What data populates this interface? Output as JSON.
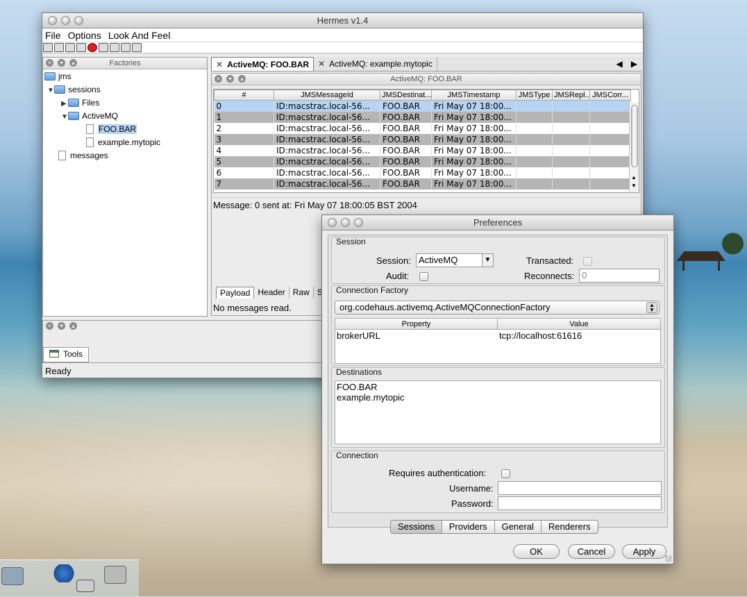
{
  "hermes": {
    "title": "Hermes v1.4",
    "menu": [
      "File",
      "Options",
      "Look And Feel"
    ],
    "factories_title": "Factories",
    "tree": [
      {
        "label": "jms"
      },
      {
        "label": "sessions"
      },
      {
        "label": "Files"
      },
      {
        "label": "ActiveMQ"
      },
      {
        "label": "FOO.BAR"
      },
      {
        "label": "example.mytopic"
      },
      {
        "label": "messages"
      }
    ],
    "tabs": [
      "ActiveMQ: FOO.BAR",
      "ActiveMQ: example.mytopic"
    ],
    "panel_title": "ActiveMQ: FOO.BAR",
    "columns": [
      "#",
      "JMSMessageId",
      "JMSDestinat...",
      "JMSTimestamp",
      "JMSType",
      "JMSRepl...",
      "JMSCorr..."
    ],
    "rows": [
      {
        "n": "0",
        "id": "ID:macstrac.local-56...",
        "dest": "FOO.BAR",
        "ts": "Fri May 07 18:00..."
      },
      {
        "n": "1",
        "id": "ID:macstrac.local-56...",
        "dest": "FOO.BAR",
        "ts": "Fri May 07 18:00..."
      },
      {
        "n": "2",
        "id": "ID:macstrac.local-56...",
        "dest": "FOO.BAR",
        "ts": "Fri May 07 18:00..."
      },
      {
        "n": "3",
        "id": "ID:macstrac.local-56...",
        "dest": "FOO.BAR",
        "ts": "Fri May 07 18:00..."
      },
      {
        "n": "4",
        "id": "ID:macstrac.local-56...",
        "dest": "FOO.BAR",
        "ts": "Fri May 07 18:00..."
      },
      {
        "n": "5",
        "id": "ID:macstrac.local-56...",
        "dest": "FOO.BAR",
        "ts": "Fri May 07 18:00..."
      },
      {
        "n": "6",
        "id": "ID:macstrac.local-56...",
        "dest": "FOO.BAR",
        "ts": "Fri May 07 18:00..."
      },
      {
        "n": "7",
        "id": "ID:macstrac.local-56...",
        "dest": "FOO.BAR",
        "ts": "Fri May 07 18:00..."
      }
    ],
    "message_info": "Message: 0 sent at: Fri May 07 18:00:05 BST 2004",
    "detail_tabs": [
      "Payload",
      "Header",
      "Raw",
      "Sta"
    ],
    "no_messages": "No messages read.",
    "tools_tab": "Tools",
    "status": "Ready"
  },
  "prefs": {
    "title": "Preferences",
    "session_group": "Session",
    "session_label": "Session:",
    "session_value": "ActiveMQ",
    "transacted_label": "Transacted:",
    "audit_label": "Audit:",
    "reconnects_label": "Reconnects:",
    "reconnects_value": "0",
    "cf_group": "Connection Factory",
    "cf_value": "org.codehaus.activemq.ActiveMQConnectionFactory",
    "prop_header": "Property",
    "value_header": "Value",
    "prop_name": "brokerURL",
    "prop_value": "tcp://localhost:61616",
    "dest_group": "Destinations",
    "destinations": [
      "FOO.BAR",
      "example.mytopic"
    ],
    "conn_group": "Connection",
    "auth_label": "Requires authentication:",
    "username_label": "Username:",
    "password_label": "Password:",
    "segments": [
      "Sessions",
      "Providers",
      "General",
      "Renderers"
    ],
    "ok": "OK",
    "cancel": "Cancel",
    "apply": "Apply"
  }
}
